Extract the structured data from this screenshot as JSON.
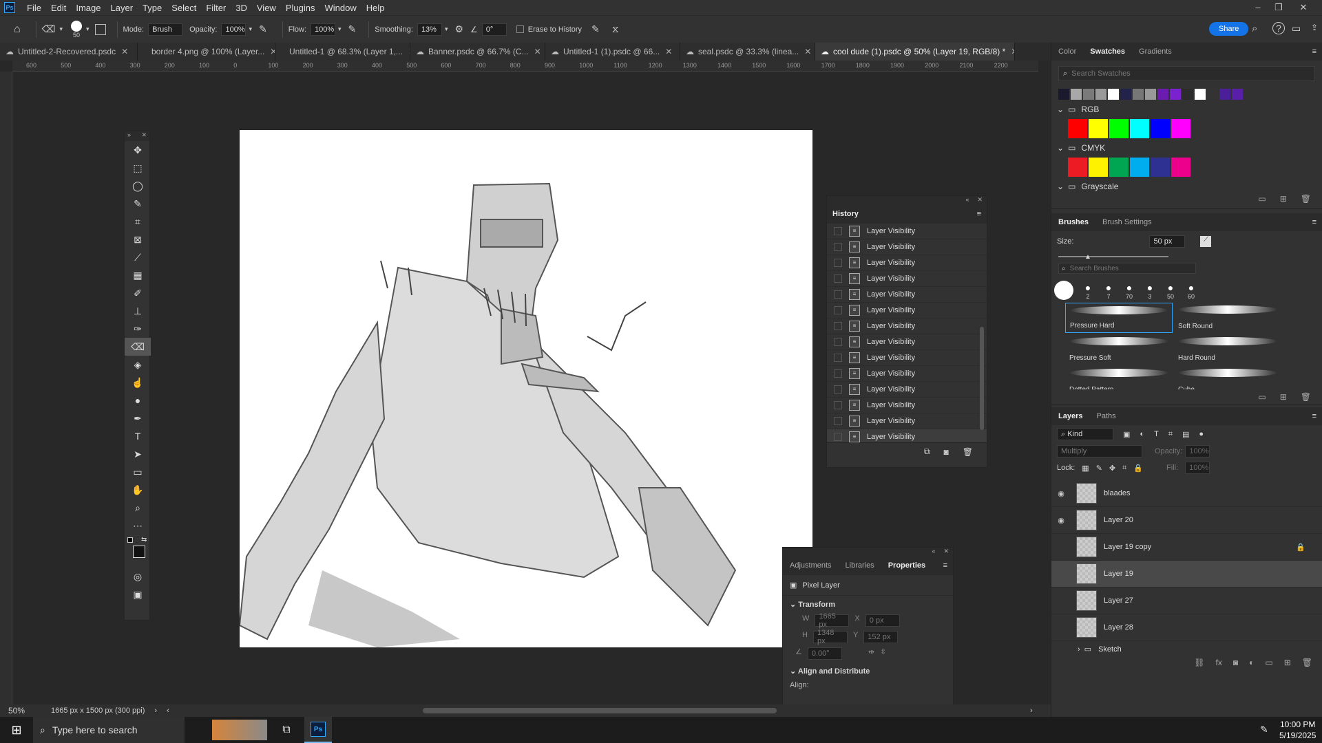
{
  "app": {
    "logo": "Ps"
  },
  "menu": [
    "File",
    "Edit",
    "Image",
    "Layer",
    "Type",
    "Select",
    "Filter",
    "3D",
    "View",
    "Plugins",
    "Window",
    "Help"
  ],
  "options": {
    "brush_size": "50",
    "mode_label": "Mode:",
    "mode_value": "Brush",
    "opacity_label": "Opacity:",
    "opacity_value": "100%",
    "flow_label": "Flow:",
    "flow_value": "100%",
    "smoothing_label": "Smoothing:",
    "smoothing_value": "13%",
    "angle_value": "0°",
    "erase_history": "Erase to History",
    "share": "Share"
  },
  "tabs": [
    {
      "label": "Untitled-2-Recovered.psdc"
    },
    {
      "label": "border 4.png @ 100% (Layer..."
    },
    {
      "label": "Untitled-1 @ 68.3% (Layer 1,..."
    },
    {
      "label": "Banner.psdc @ 66.7% (C..."
    },
    {
      "label": "Untitled-1 (1).psdc @ 66..."
    },
    {
      "label": "seal.psdc @ 33.3% (linea..."
    },
    {
      "label": "cool dude (1).psdc @ 50% (Layer 19, RGB/8) *"
    }
  ],
  "ruler_ticks": [
    "600",
    "500",
    "400",
    "300",
    "200",
    "100",
    "0",
    "100",
    "200",
    "300",
    "400",
    "500",
    "600",
    "700",
    "800",
    "900",
    "1000",
    "1100",
    "1200",
    "1300",
    "1400",
    "1500",
    "1600",
    "1700",
    "1800",
    "1900",
    "2000",
    "2100",
    "2200"
  ],
  "history": {
    "title": "History",
    "items": [
      "Layer Visibility",
      "Layer Visibility",
      "Layer Visibility",
      "Layer Visibility",
      "Layer Visibility",
      "Layer Visibility",
      "Layer Visibility",
      "Layer Visibility",
      "Layer Visibility",
      "Layer Visibility",
      "Layer Visibility",
      "Layer Visibility",
      "Layer Visibility",
      "Layer Visibility"
    ]
  },
  "properties": {
    "tabs": [
      "Adjustments",
      "Libraries",
      "Properties"
    ],
    "kind": "Pixel Layer",
    "transform": "Transform",
    "w": "1665 px",
    "h": "1348 px",
    "x": "0 px",
    "y": "152 px",
    "angle": "0.00°",
    "align": "Align and Distribute",
    "align_label": "Align:"
  },
  "swatches": {
    "tabs": [
      "Color",
      "Swatches",
      "Gradients"
    ],
    "search_placeholder": "Search Swatches",
    "recent": [
      "#1a1a2e",
      "#a8a8a8",
      "#7a7a7a",
      "#9a9a9a",
      "#ffffff",
      "#22224a",
      "#777777",
      "#999999",
      "#6a1bb0",
      "#7b22d0",
      "#2c2c2c",
      "#ffffff",
      "#333333",
      "#4b1f9a",
      "#5a1fa8"
    ],
    "groups": [
      {
        "name": "RGB",
        "colors": [
          "#ff0000",
          "#ffff00",
          "#00ff00",
          "#00ffff",
          "#0000ff",
          "#ff00ff"
        ]
      },
      {
        "name": "CMYK",
        "colors": [
          "#ed1c24",
          "#fff200",
          "#00a651",
          "#00aeef",
          "#2e3192",
          "#ec008c"
        ]
      },
      {
        "name": "Grayscale",
        "colors": []
      }
    ]
  },
  "brushes": {
    "tabs": [
      "Brushes",
      "Brush Settings"
    ],
    "size_label": "Size:",
    "size_value": "50 px",
    "search_placeholder": "Search Brushes",
    "recent_sizes": [
      "2",
      "7",
      "70",
      "3",
      "50",
      "60"
    ],
    "presets": [
      "Pressure Hard",
      "Soft Round",
      "Pressure Soft",
      "Hard Round",
      "Dotted Pattern",
      "Cube"
    ]
  },
  "layers": {
    "tabs": [
      "Layers",
      "Paths"
    ],
    "kind": "Kind",
    "blend": "Multiply",
    "opacity_label": "Opacity:",
    "opacity_value": "100%",
    "lock_label": "Lock:",
    "fill_label": "Fill:",
    "fill_value": "100%",
    "items": [
      {
        "name": "blaades",
        "visible": true
      },
      {
        "name": "Layer 20",
        "visible": true
      },
      {
        "name": "Layer 19 copy",
        "visible": false
      },
      {
        "name": "Layer 19",
        "visible": false
      },
      {
        "name": "Layer 27",
        "visible": false
      },
      {
        "name": "Layer 28",
        "visible": false
      }
    ],
    "group": "Sketch"
  },
  "status": {
    "zoom": "50%",
    "doc": "1665 px x 1500 px (300 ppi)"
  },
  "taskbar": {
    "search": "Type here to search",
    "time": "10:00 PM",
    "date": "5/19/2025"
  }
}
